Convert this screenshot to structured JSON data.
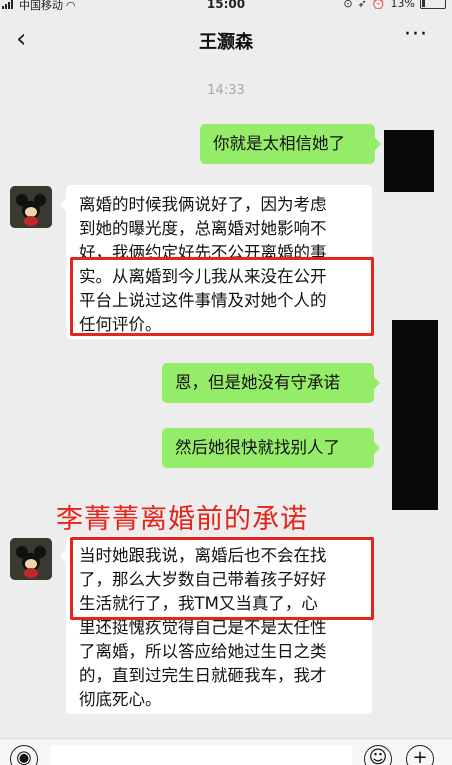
{
  "status_bar": {
    "carrier": "中国移动",
    "time": "15:00",
    "battery": "13%",
    "battery_level": 0.13
  },
  "nav": {
    "title": "王灏森",
    "back_icon": "‹",
    "more_icon": "···"
  },
  "timestamp": "14:33",
  "messages": [
    {
      "from": "me",
      "text": "你就是太相信她了"
    },
    {
      "from": "them",
      "lines": [
        "离婚的时候我俩说好了，因为考虑",
        "到她的曝光度，总离婚对她影响不",
        "好，我俩约定好先不公开离婚的事",
        "实。从离婚到今儿我从来没在公开",
        "平台上说过这件事情及对她个人的",
        "任何评价。"
      ]
    },
    {
      "from": "me",
      "text": "恩，但是她没有守承诺"
    },
    {
      "from": "me",
      "text": "然后她很快就找别人了"
    },
    {
      "from": "them",
      "lines": [
        "当时她跟我说，离婚后也不会在找",
        "了，那么大岁数自己带着孩子好好",
        "生活就行了，我TM又当真了，心",
        "里还挺愧疚觉得自己是不是太任性",
        "了离婚，所以答应给她过生日之类",
        "的，直到过完生日就砸我车，我才",
        "彻底死心。"
      ]
    }
  ],
  "caption": "李菁菁离婚前的承诺",
  "input_bar": {
    "voice_icon": "voice-icon",
    "emoji_icon": "emoji-icon",
    "plus_icon": "plus-icon"
  },
  "colors": {
    "my_bubble": "#95ec69",
    "their_bubble": "#ffffff",
    "highlight": "#e3251c",
    "background": "#ededed"
  }
}
